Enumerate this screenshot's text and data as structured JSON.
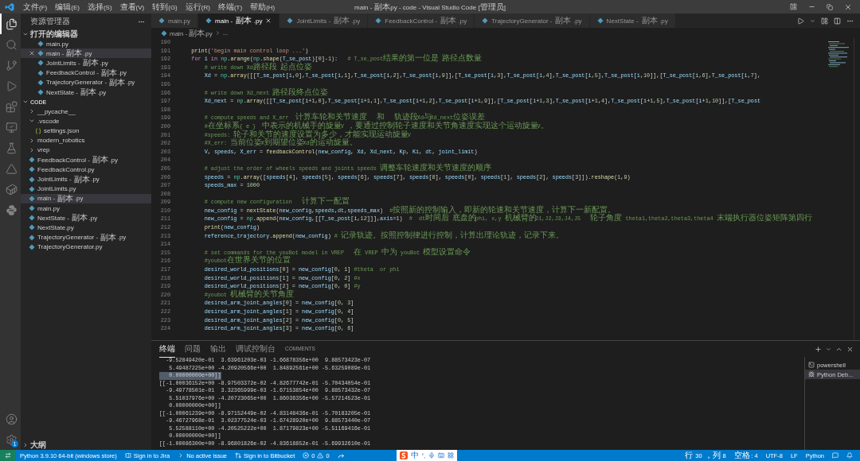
{
  "window": {
    "title": "main - 副本.py - code - Visual Studio Code [管理员]"
  },
  "menu": [
    "文件(F)",
    "编辑(E)",
    "选择(S)",
    "查看(V)",
    "转到(G)",
    "运行(R)",
    "终端(T)",
    "帮助(H)"
  ],
  "activity_bar": [
    {
      "selected": true
    },
    {
      "selected": false
    },
    {
      "selected": false
    },
    {
      "selected": false
    },
    {
      "selected": false
    },
    {
      "selected": false
    },
    {
      "selected": false
    },
    {
      "selected": false
    },
    {
      "selected": false
    },
    {
      "selected": false
    }
  ],
  "settings_badge": "1",
  "sidebar": {
    "title": "资源管理器",
    "sections": [
      {
        "title": "打开的编辑器",
        "expanded": true,
        "items": [
          {
            "label": "main.py",
            "kind": "python",
            "selected": false
          },
          {
            "label": "main - 副本.py",
            "kind": "python",
            "selected": true
          },
          {
            "label": "JointLimits - 副本.py",
            "kind": "python",
            "selected": false
          },
          {
            "label": "FeedbackControl - 副本.py",
            "kind": "python",
            "selected": false
          },
          {
            "label": "TrajectoryGenerator - 副本.py",
            "kind": "python",
            "selected": false
          },
          {
            "label": "NextState - 副本.py",
            "kind": "python",
            "selected": false
          }
        ]
      },
      {
        "title": "CODE",
        "expanded": true,
        "items": [
          {
            "label": "__pycache__",
            "kind": "folder",
            "expanded": false,
            "selected": false
          },
          {
            "label": ".vscode",
            "kind": "folder",
            "expanded": true,
            "selected": false,
            "children": [
              {
                "label": "settings.json",
                "kind": "json",
                "selected": false
              }
            ]
          },
          {
            "label": "modern_robotics",
            "kind": "folder",
            "expanded": false,
            "selected": false
          },
          {
            "label": "vrep",
            "kind": "folder",
            "expanded": false,
            "selected": false
          },
          {
            "label": "FeedbackControl - 副本.py",
            "kind": "python",
            "selected": false
          },
          {
            "label": "FeedbackControl.py",
            "kind": "python",
            "selected": false
          },
          {
            "label": "JointLimits - 副本.py",
            "kind": "python",
            "selected": false
          },
          {
            "label": "JointLimits.py",
            "kind": "python",
            "selected": false
          },
          {
            "label": "main - 副本.py",
            "kind": "python",
            "selected": true
          },
          {
            "label": "main.py",
            "kind": "python",
            "selected": false
          },
          {
            "label": "NextState - 副本.py",
            "kind": "python",
            "selected": false
          },
          {
            "label": "NextState.py",
            "kind": "python",
            "selected": false
          },
          {
            "label": "TrajectoryGenerator - 副本.py",
            "kind": "python",
            "selected": false
          },
          {
            "label": "TrajectoryGenerator.py",
            "kind": "python",
            "selected": false
          }
        ]
      },
      {
        "title": "大纲",
        "expanded": false
      }
    ]
  },
  "tabs": [
    {
      "label": "main.py",
      "selected": false
    },
    {
      "label": "main - 副本.py",
      "selected": true
    },
    {
      "label": "JointLimits - 副本.py",
      "selected": false
    },
    {
      "label": "FeedbackControl - 副本.py",
      "selected": false
    },
    {
      "label": "TrajectoryGenerator - 副本.py",
      "selected": false
    },
    {
      "label": "NextState - 副本.py",
      "selected": false
    }
  ],
  "breadcrumb": [
    "main - 副本.py",
    "..."
  ],
  "editor": {
    "lines": [
      {
        "number": "190"
      },
      {
        "number": "191",
        "text": "    print('begin main control loop ...')"
      },
      {
        "number": "192",
        "text": "    for i in np.arange(np.shape(T_se_post)[0]-1):   # T_se_post结果的第一位是 路径点数量"
      },
      {
        "number": "193",
        "text": "        # write down Xd路径段 起点位姿"
      },
      {
        "number": "194",
        "text": "        Xd = np.array([[T_se_post[i,0],T_se_post[i,1],T_se_post[i,2],T_se_post[i,9]],[T_se_post[i,3],T_se_post[i,4],T_se_post[i,5],T_se_post[i,10]],[T_se_post[i,6],T_se_post[i,7],"
      },
      {
        "number": "195"
      },
      {
        "number": "196",
        "text": "        # write down Xd_next 路径段终点位姿"
      },
      {
        "number": "197",
        "text": "        Xd_next = np.array([[T_se_post[i+1,0],T_se_post[i+1,1],T_se_post[i+1,2],T_se_post[i+1,9]],[T_se_post[i+1,3],T_se_post[i+1,4],T_se_post[i+1,5],T_se_post[i+1,10]],[T_se_post"
      },
      {
        "number": "198"
      },
      {
        "number": "199",
        "text": "        # compute speeds and X_err  计算车轮和关节速度   和   轨迹段Xd与Xd_next位姿误差"
      },
      {
        "number": "200",
        "text": "        #在坐标系{ e }  中表示的机械手的旋量V ，要通过控制轮子速度和关节角速度实现这个运动旋量V。"
      },
      {
        "number": "201",
        "text": "        #speeds: 轮子和关节的速度设置为多少，才能实现运动旋量V"
      },
      {
        "number": "202",
        "text": "        #X_err: 当前位姿X到期望位姿Xd的运动旋量。"
      },
      {
        "number": "203",
        "text": "        V, speeds, X_err = feedbackControl(new_config, Xd, Xd_next, Kp, Ki, dt, joint_limit)"
      },
      {
        "number": "204"
      },
      {
        "number": "205",
        "text": "        # adjust the order of wheels speeds and joints speeds 调整车轮速度和关节速度的顺序"
      },
      {
        "number": "206",
        "text": "        speeds = np.array([speeds[4], speeds[5], speeds[6], speeds[7], speeds[8], speeds[0], speeds[1], speeds[2], speeds[3]]).reshape(1,9)"
      },
      {
        "number": "207",
        "text": "        speeds_max = 1000"
      },
      {
        "number": "208"
      },
      {
        "number": "209",
        "text": "        # compute new configuration   计算下一配置"
      },
      {
        "number": "210",
        "text": "        new_config = nextState(new_config,speeds,dt,speeds_max)  #按照新的控制输入，即新的轮速和关节速度，计算下一新配置。"
      },
      {
        "number": "211",
        "text": "        new_config = np.append(new_config,[[T_se_post[i,12]]],axis=1)  #  dt时间后 底盘的phi, x,y 机械臂的J1,J2,J3,J4,J5   轮子角度 theta1,theta2,theta3,theta4 末端执行器位姿矩阵第四行"
      },
      {
        "number": "212",
        "text": "        print(new_config)"
      },
      {
        "number": "213",
        "text": "        reference_trajectory.append(new_config) # 记录轨迹。按照控制律进行控制，计算出理论轨迹，记录下来。"
      },
      {
        "number": "214"
      },
      {
        "number": "215",
        "text": "        # set commands for the youBot model in VREP   在 VREP 中为 youBot 模型设置命令"
      },
      {
        "number": "216",
        "text": "        #youbot在世界关节的位置"
      },
      {
        "number": "217",
        "text": "        desired_world_positions[0] = new_config[0, 1] #theta  or phi"
      },
      {
        "number": "218",
        "text": "        desired_world_positions[1] = new_config[0, 2] #x"
      },
      {
        "number": "219",
        "text": "        desired_world_positions[2] = new_config[0, 0] #y"
      },
      {
        "number": "220",
        "text": "        #youbot 机械臂的关节角度"
      },
      {
        "number": "221",
        "text": "        desired_arm_joint_angles[0] = new_config[0, 3]"
      },
      {
        "number": "222",
        "text": "        desired_arm_joint_angles[1] = new_config[0, 4]"
      },
      {
        "number": "223",
        "text": "        desired_arm_joint_angles[2] = new_config[0, 5]"
      },
      {
        "number": "224",
        "text": "        desired_arm_joint_angles[3] = new_config[0, 6]"
      }
    ]
  },
  "panel": {
    "tabs": [
      {
        "label": "终端",
        "selected": true
      },
      {
        "label": "问题",
        "selected": false
      },
      {
        "label": "输出",
        "selected": false
      },
      {
        "label": "调试控制台",
        "selected": false
      },
      {
        "label": "COMMENTS",
        "selected": false
      }
    ],
    "terminal_lines": [
      {
        "text": "  -9.52849420e-01  3.63961203e-03 -1.66878356e+00  9.88573423e-07",
        "highlighted": false
      },
      {
        "text": "   5.49487225e+00 -4.20920566e+00  1.84892561e+00 -5.63259089e-01",
        "highlighted": false
      },
      {
        "text": "   0.00000000e+00]]",
        "highlighted": true
      },
      {
        "text": "[[-1.00036152e+00 -8.97503372e-02 -4.82677742e-01 -5.70434054e-01",
        "highlighted": false
      },
      {
        "text": "  -9.49778501e-01  3.32365999e-03 -1.67153854e+00  9.88573432e-07",
        "highlighted": false
      },
      {
        "text": "   5.51037976e+00 -4.20723065e+00  1.86036356e+00 -5.57214523e-01",
        "highlighted": false
      },
      {
        "text": "   0.00000000e+00]]",
        "highlighted": false
      },
      {
        "text": "[[-1.00061239e+00 -8.97152449e-02 -4.83148436e-01 -5.70183205e-01",
        "highlighted": false
      },
      {
        "text": "  -9.46727968e-01  3.02377524e-03 -1.67428920e+00  9.88573440e-07",
        "highlighted": false
      },
      {
        "text": "   5.52588110e+00 -4.20525222e+00  1.87179823e+00 -5.51169416e-01",
        "highlighted": false
      },
      {
        "text": "   0.00000000e+00]]",
        "highlighted": false
      },
      {
        "text": "[[-1.00086300e+00 -8.96801826e-02 -4.83618852e-01 -5.69932610e-01",
        "highlighted": false
      }
    ],
    "terminals": [
      {
        "label": "powershell",
        "kind": "shell",
        "selected": false
      },
      {
        "label": "Python Deb...",
        "kind": "debug",
        "selected": true
      }
    ]
  },
  "status_bar": {
    "left": [
      {
        "kind": "remote"
      },
      {
        "kind": "python",
        "text": "Python 3.9.10 64-bit (windows store)"
      },
      {
        "kind": "jira",
        "text": "Sign in to Jira"
      },
      {
        "kind": "issue",
        "text": "No active issue"
      },
      {
        "kind": "bitbucket",
        "text": "Sign in to Bitbucket"
      },
      {
        "kind": "problems",
        "errors": "0",
        "warnings": "0"
      },
      {
        "kind": "share"
      },
      {
        "kind": "ime",
        "text": "中",
        "punct": "°,"
      }
    ],
    "right": [
      {
        "kind": "text",
        "text": "行 30，列 8"
      },
      {
        "kind": "text",
        "text": "空格: 4"
      },
      {
        "kind": "text",
        "text": "UTF-8"
      },
      {
        "kind": "text",
        "text": "LF"
      },
      {
        "kind": "text",
        "text": "Python"
      },
      {
        "kind": "feedback"
      },
      {
        "kind": "bell"
      }
    ]
  }
}
